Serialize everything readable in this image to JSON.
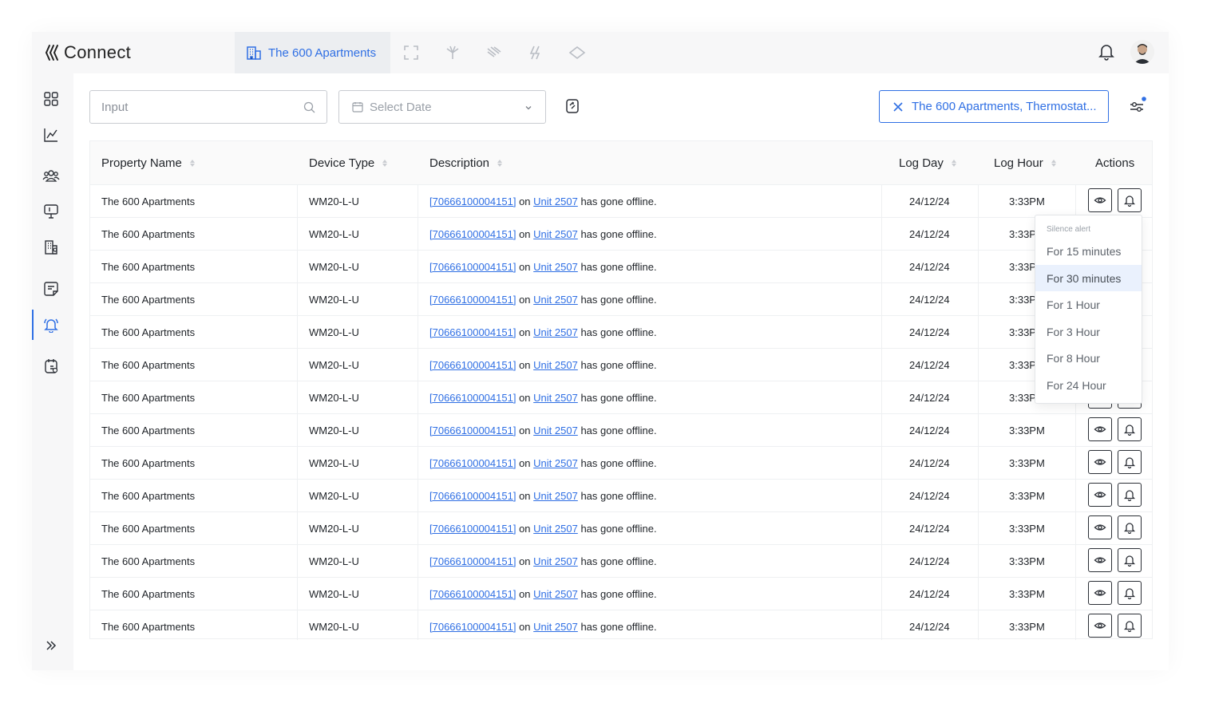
{
  "app": {
    "name": "Connect"
  },
  "topbar": {
    "active_tab": "The 600 Apartments",
    "tab_icons": [
      "building-icon",
      "expand-icon",
      "hvac-icon",
      "wind-icon",
      "energy-icon",
      "loop-icon"
    ]
  },
  "sidebar": {
    "items": [
      {
        "name": "dashboard-icon"
      },
      {
        "name": "analytics-icon"
      },
      {
        "name": "users-icon"
      },
      {
        "name": "monitor-icon"
      },
      {
        "name": "properties-icon"
      },
      {
        "name": "notes-icon"
      },
      {
        "name": "alerts-icon",
        "active": true
      },
      {
        "name": "billing-icon"
      }
    ],
    "expand": "expand-sidebar-icon"
  },
  "filters": {
    "search_placeholder": "Input",
    "date_placeholder": "Select Date",
    "active_filter": "The 600 Apartments, Thermostat..."
  },
  "table": {
    "columns": [
      "Property Name",
      "Device Type",
      "Description",
      "Log Day",
      "Log Hour",
      "Actions"
    ],
    "rows": [
      {
        "property": "The 600 Apartments",
        "device": "WM20-L-U",
        "device_id": "[70666100004151]",
        "on": "on",
        "unit": "Unit 2507",
        "status": "has gone offline.",
        "day": "24/12/24",
        "hour": "3:33PM"
      },
      {
        "property": "The 600 Apartments",
        "device": "WM20-L-U",
        "device_id": "[70666100004151]",
        "on": "on",
        "unit": "Unit 2507",
        "status": "has gone offline.",
        "day": "24/12/24",
        "hour": "3:33PM"
      },
      {
        "property": "The 600 Apartments",
        "device": "WM20-L-U",
        "device_id": "[70666100004151]",
        "on": "on",
        "unit": "Unit 2507",
        "status": "has gone offline.",
        "day": "24/12/24",
        "hour": "3:33PM"
      },
      {
        "property": "The 600 Apartments",
        "device": "WM20-L-U",
        "device_id": "[70666100004151]",
        "on": "on",
        "unit": "Unit 2507",
        "status": "has gone offline.",
        "day": "24/12/24",
        "hour": "3:33PM"
      },
      {
        "property": "The 600 Apartments",
        "device": "WM20-L-U",
        "device_id": "[70666100004151]",
        "on": "on",
        "unit": "Unit 2507",
        "status": "has gone offline.",
        "day": "24/12/24",
        "hour": "3:33PM"
      },
      {
        "property": "The 600 Apartments",
        "device": "WM20-L-U",
        "device_id": "[70666100004151]",
        "on": "on",
        "unit": "Unit 2507",
        "status": "has gone offline.",
        "day": "24/12/24",
        "hour": "3:33PM"
      },
      {
        "property": "The 600 Apartments",
        "device": "WM20-L-U",
        "device_id": "[70666100004151]",
        "on": "on",
        "unit": "Unit 2507",
        "status": "has gone offline.",
        "day": "24/12/24",
        "hour": "3:33PM"
      },
      {
        "property": "The 600 Apartments",
        "device": "WM20-L-U",
        "device_id": "[70666100004151]",
        "on": "on",
        "unit": "Unit 2507",
        "status": "has gone offline.",
        "day": "24/12/24",
        "hour": "3:33PM"
      },
      {
        "property": "The 600 Apartments",
        "device": "WM20-L-U",
        "device_id": "[70666100004151]",
        "on": "on",
        "unit": "Unit 2507",
        "status": "has gone offline.",
        "day": "24/12/24",
        "hour": "3:33PM"
      },
      {
        "property": "The 600 Apartments",
        "device": "WM20-L-U",
        "device_id": "[70666100004151]",
        "on": "on",
        "unit": "Unit 2507",
        "status": "has gone offline.",
        "day": "24/12/24",
        "hour": "3:33PM"
      },
      {
        "property": "The 600 Apartments",
        "device": "WM20-L-U",
        "device_id": "[70666100004151]",
        "on": "on",
        "unit": "Unit 2507",
        "status": "has gone offline.",
        "day": "24/12/24",
        "hour": "3:33PM"
      },
      {
        "property": "The 600 Apartments",
        "device": "WM20-L-U",
        "device_id": "[70666100004151]",
        "on": "on",
        "unit": "Unit 2507",
        "status": "has gone offline.",
        "day": "24/12/24",
        "hour": "3:33PM"
      },
      {
        "property": "The 600 Apartments",
        "device": "WM20-L-U",
        "device_id": "[70666100004151]",
        "on": "on",
        "unit": "Unit 2507",
        "status": "has gone offline.",
        "day": "24/12/24",
        "hour": "3:33PM"
      },
      {
        "property": "The 600 Apartments",
        "device": "WM20-L-U",
        "device_id": "[70666100004151]",
        "on": "on",
        "unit": "Unit 2507",
        "status": "has gone offline.",
        "day": "24/12/24",
        "hour": "3:33PM"
      }
    ]
  },
  "silence_menu": {
    "title": "Silence alert",
    "options": [
      "For  15 minutes",
      "For  30 minutes",
      "For  1 Hour",
      "For  3 Hour",
      "For  8 Hour",
      "For  24 Hour"
    ],
    "selected_index": 1
  },
  "colors": {
    "accent": "#2f6fe4",
    "border": "#c9ccd1"
  }
}
